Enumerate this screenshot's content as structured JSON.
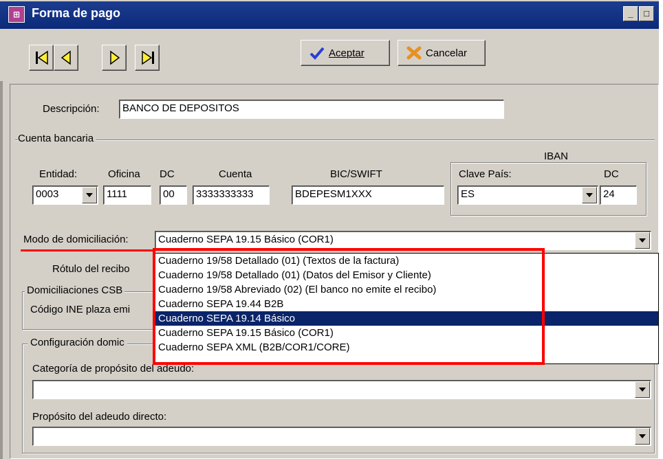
{
  "window": {
    "title": "Forma de pago",
    "icon": "form-app-icon"
  },
  "toolbar": {
    "nav_icons": [
      "first-record-icon",
      "previous-record-icon",
      "next-record-icon",
      "last-record-icon"
    ],
    "accept_label": "Aceptar",
    "cancel_label": "Cancelar"
  },
  "form": {
    "descripcion_label": "Descripción:",
    "descripcion_value": "BANCO DE DEPOSITOS",
    "cuenta_group": "Cuenta bancaria",
    "iban_label": "IBAN",
    "entidad_label": "Entidad:",
    "entidad_value": "0003",
    "oficina_label": "Oficina",
    "oficina_value": "1111",
    "dc_label": "DC",
    "dc_value": "00",
    "cuenta_label": "Cuenta",
    "cuenta_value": "3333333333",
    "bic_label": "BIC/SWIFT",
    "bic_value": "BDEPESM1XXX",
    "clave_pais_label": "Clave País:",
    "clave_pais_value": "ES",
    "iban_dc_label": "DC",
    "iban_dc_value": "24",
    "modo_label": "Modo de domiciliación:",
    "modo_value": "Cuaderno SEPA 19.15 Básico (COR1)",
    "rotulo_label": "Rótulo del recibo",
    "csb_group": "Domiciliaciones CSB",
    "ine_label": "Código INE plaza emi",
    "config_group": "Configuración domic",
    "categoria_label": "Categoría de propósito del adeudo:",
    "proposito_label": "Propósito del adeudo directo:"
  },
  "dropdown_options": [
    "Cuaderno 19/58  Detallado (01)  (Textos de la factura)",
    "Cuaderno 19/58  Detallado (01)  (Datos del Emisor y Cliente)",
    "Cuaderno 19/58  Abreviado (02)  (El banco no emite el recibo)",
    "Cuaderno SEPA 19.44 B2B",
    "Cuaderno SEPA 19.14 Básico",
    "Cuaderno SEPA 19.15 Básico (COR1)",
    "Cuaderno SEPA XML (B2B/COR1/CORE)"
  ],
  "dropdown_selected_index": 4,
  "colors": {
    "title_bar": "#0c2a7a",
    "selection": "#0a246a",
    "highlight": "#ff0000",
    "face": "#d4d0c8"
  }
}
